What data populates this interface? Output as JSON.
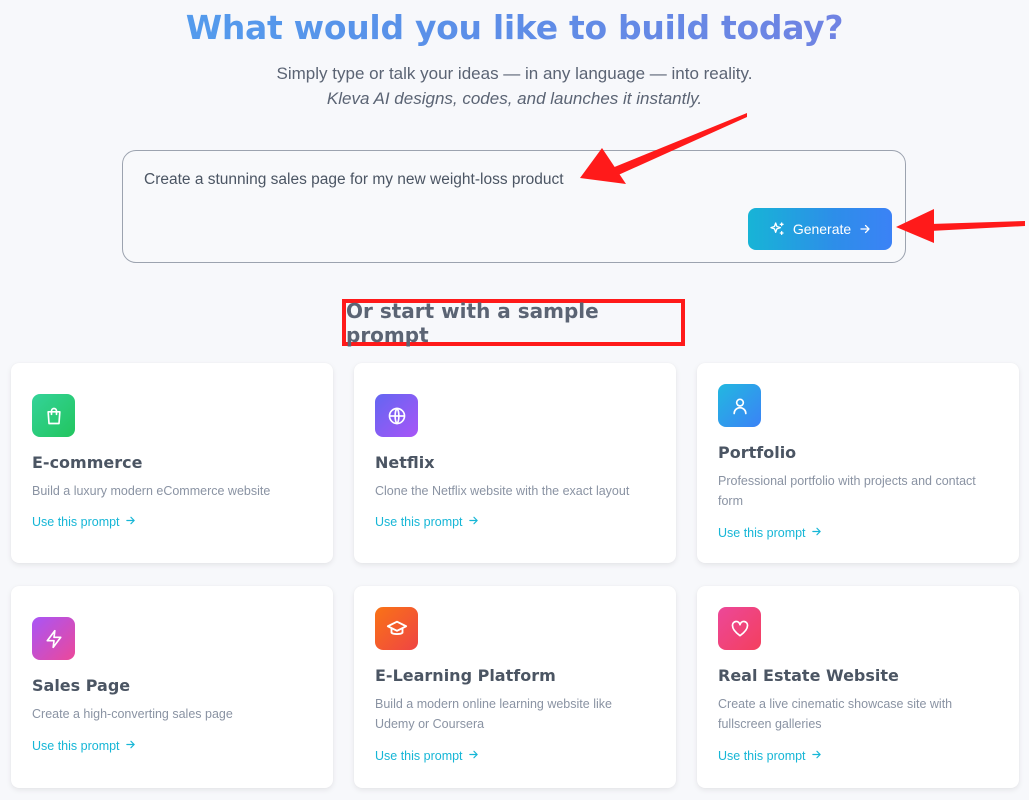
{
  "hero": {
    "title": "What would you like to build today?",
    "subtitle": "Simply type or talk your ideas — in any language — into reality.",
    "tagline": "Kleva AI designs, codes, and launches it instantly."
  },
  "prompt": {
    "value": "Create a stunning sales page for my new weight-loss product",
    "generate_label": "Generate"
  },
  "samples": {
    "heading": "Or start with a sample prompt",
    "link_label": "Use this prompt",
    "cards": [
      {
        "title": "E-commerce",
        "description": "Build a luxury modern eCommerce website",
        "icon": "shopping-bag-icon",
        "color": "#22c55e"
      },
      {
        "title": "Netflix",
        "description": "Clone the Netflix website with the exact layout",
        "icon": "globe-icon",
        "color": "#8b5cf6"
      },
      {
        "title": "Portfolio",
        "description": "Professional portfolio with projects and contact form",
        "icon": "user-icon",
        "color": "#3b82f6"
      },
      {
        "title": "Sales Page",
        "description": "Create a high-converting sales page",
        "icon": "lightning-icon",
        "color": "#c026d3"
      },
      {
        "title": "E-Learning Platform",
        "description": "Build a modern online learning website like Udemy or Coursera",
        "icon": "graduation-cap-icon",
        "color": "#f97316"
      },
      {
        "title": "Real Estate Website",
        "description": "Create a live cinematic showcase site with fullscreen galleries",
        "icon": "heart-icon",
        "color": "#ec4899"
      }
    ]
  },
  "colors": {
    "accent": "#16b6d6",
    "annotation_red": "#ff1a1a"
  }
}
